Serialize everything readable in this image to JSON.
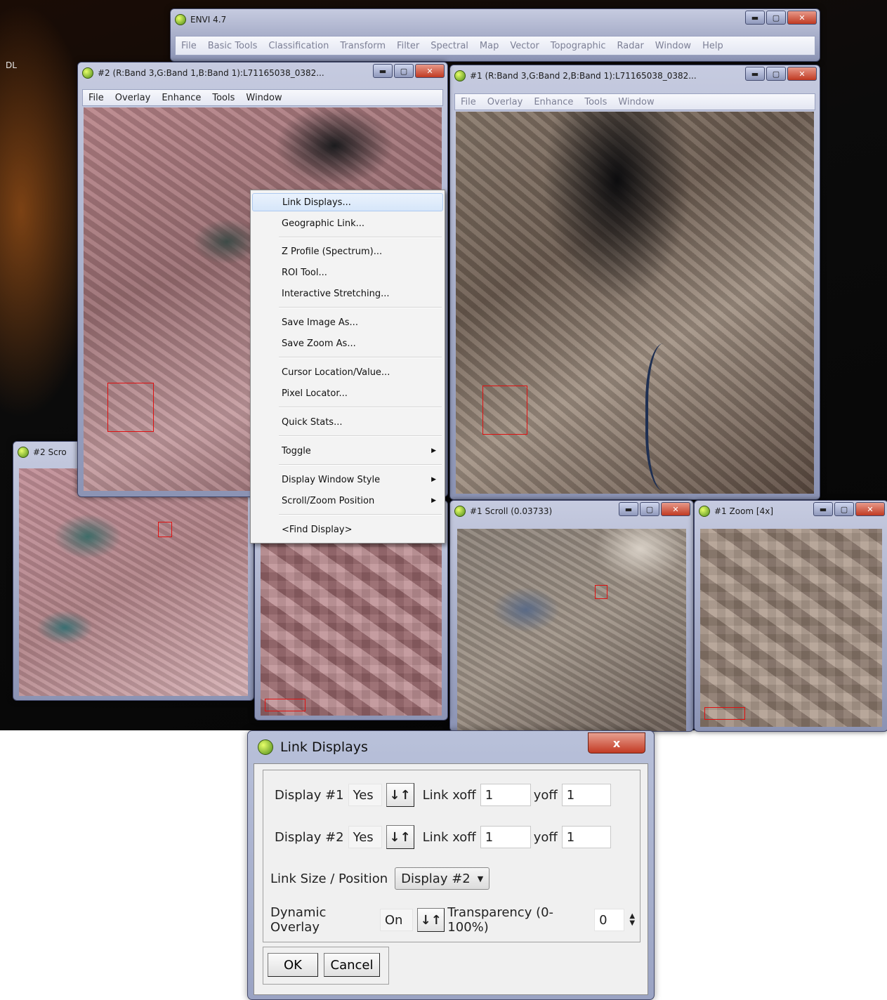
{
  "desktop": {
    "label": "DL"
  },
  "main_window": {
    "title": "ENVI 4.7",
    "menu": [
      "File",
      "Basic Tools",
      "Classification",
      "Transform",
      "Filter",
      "Spectral",
      "Map",
      "Vector",
      "Topographic",
      "Radar",
      "Window",
      "Help"
    ]
  },
  "display2": {
    "title": "#2 (R:Band 3,G:Band 1,B:Band 1):L71165038_0382...",
    "menu": [
      "File",
      "Overlay",
      "Enhance",
      "Tools",
      "Window"
    ]
  },
  "display1": {
    "title": "#1 (R:Band 3,G:Band 2,B:Band 1):L71165038_0382...",
    "menu": [
      "File",
      "Overlay",
      "Enhance",
      "Tools",
      "Window"
    ]
  },
  "scroll2": {
    "title": "#2 Scro"
  },
  "scroll1": {
    "title": "#1 Scroll (0.03733)"
  },
  "zoom1": {
    "title": "#1 Zoom [4x]"
  },
  "tools_menu": {
    "items": [
      {
        "label": "Link Displays...",
        "highlighted": true,
        "submenu": false
      },
      {
        "label": "Geographic Link...",
        "submenu": false
      },
      {
        "label": "Z Profile (Spectrum)...",
        "submenu": false
      },
      {
        "label": "ROI Tool...",
        "submenu": false
      },
      {
        "label": "Interactive Stretching...",
        "submenu": false
      },
      {
        "label": "Save Image As...",
        "submenu": false
      },
      {
        "label": "Save Zoom As...",
        "submenu": false
      },
      {
        "label": "Cursor Location/Value...",
        "submenu": false
      },
      {
        "label": "Pixel Locator...",
        "submenu": false
      },
      {
        "label": "Quick Stats...",
        "submenu": false
      },
      {
        "label": "Toggle",
        "submenu": true
      },
      {
        "label": "Display Window Style",
        "submenu": true
      },
      {
        "label": "Scroll/Zoom Position",
        "submenu": true
      },
      {
        "label": "<Find Display>",
        "submenu": false
      }
    ]
  },
  "link_dialog": {
    "title": "Link Displays",
    "close_label": "x",
    "rows": [
      {
        "label": "Display #1",
        "value": "Yes",
        "xoff_label": "Link xoff",
        "xoff": "1",
        "yoff_label": "yoff",
        "yoff": "1"
      },
      {
        "label": "Display #2",
        "value": "Yes",
        "xoff_label": "Link xoff",
        "xoff": "1",
        "yoff_label": "yoff",
        "yoff": "1"
      }
    ],
    "link_size": {
      "label": "Link Size / Position",
      "value": "Display #2"
    },
    "dynamic_overlay": {
      "label": "Dynamic Overlay",
      "value": "On"
    },
    "transparency": {
      "label": "Transparency (0-100%)",
      "value": "0"
    },
    "ok_label": "OK",
    "cancel_label": "Cancel",
    "toggle_glyph": "↓↑"
  }
}
